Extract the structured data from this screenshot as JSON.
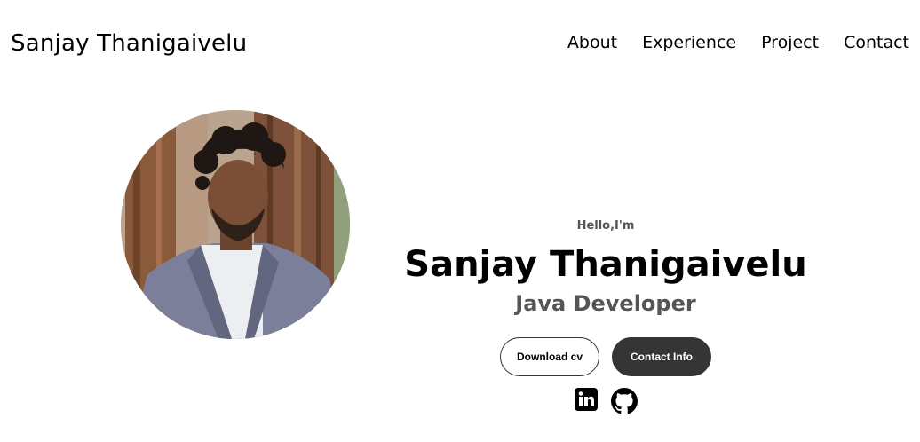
{
  "nav": {
    "logo": "Sanjay Thanigaivelu",
    "links": [
      "About",
      "Experience",
      "Project",
      "Contact"
    ]
  },
  "profile": {
    "image_icon": "profile-photo"
  },
  "hero": {
    "greeting": "Hello,I'm",
    "name": "Sanjay Thanigaivelu",
    "role": "Java Developer"
  },
  "buttons": {
    "download_label": "Download cv",
    "contact_label": "Contact Info"
  },
  "social": {
    "icons": [
      "linkedin-icon",
      "github-icon"
    ]
  },
  "colors": {
    "text": "#000000",
    "subtext": "#555555",
    "button_dark": "#353535",
    "background": "#ffffff"
  }
}
